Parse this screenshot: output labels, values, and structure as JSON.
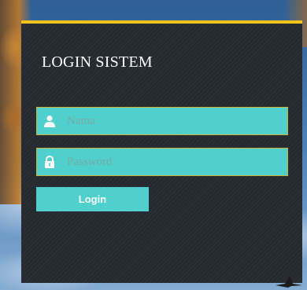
{
  "login": {
    "title": "LOGIN SISTEM",
    "username_placeholder": "Nama",
    "password_placeholder": "Password",
    "submit_label": "Login",
    "username_icon": "user-icon",
    "password_icon": "lock-icon"
  },
  "colors": {
    "accent_bar": "#f0c419",
    "field_background": "#4fd0cc",
    "panel_background": "#252a31"
  }
}
